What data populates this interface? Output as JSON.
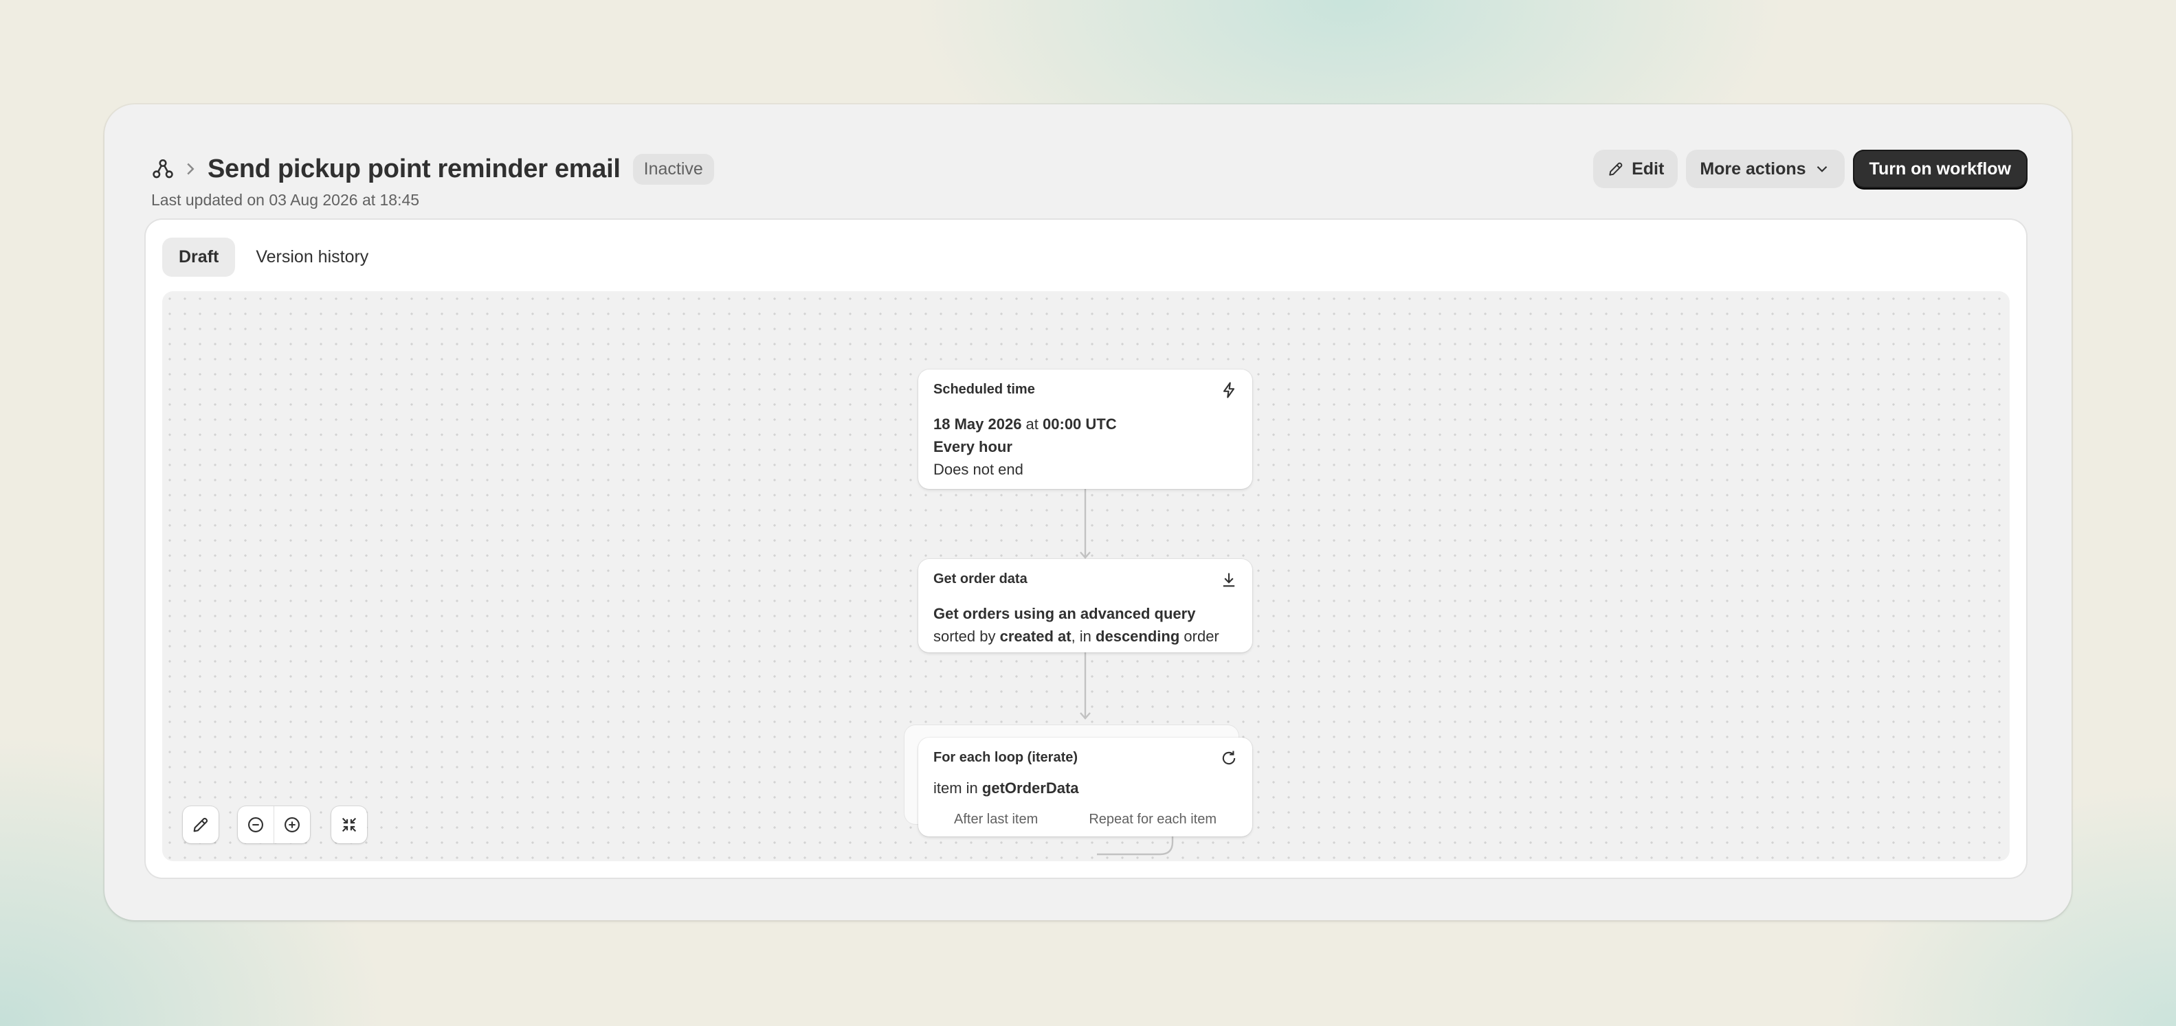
{
  "header": {
    "breadcrumb_icon": "workflow-icon",
    "title": "Send pickup point reminder email",
    "status_badge": "Inactive",
    "last_updated": "Last updated on 03 Aug 2026 at 18:45"
  },
  "actions": {
    "edit_label": "Edit",
    "more_actions_label": "More actions",
    "turn_on_label": "Turn on workflow"
  },
  "tabs": [
    {
      "label": "Draft",
      "active": true
    },
    {
      "label": "Version history",
      "active": false
    }
  ],
  "nodes": {
    "trigger": {
      "title": "Scheduled time",
      "icon": "lightning-icon",
      "date": "18 May 2026",
      "at": " at ",
      "time": "00:00 UTC",
      "frequency": "Every hour",
      "end": "Does not end"
    },
    "get_data": {
      "title": "Get order data",
      "icon": "download-icon",
      "text1": "Get orders using an advanced query",
      "text2": " sorted by ",
      "text3": "created at",
      "text4": ", in ",
      "text5": "descending",
      "text6": " order"
    },
    "loop": {
      "title": "For each loop (iterate)",
      "icon": "refresh-icon",
      "prefix": "item in ",
      "variable": "getOrderData",
      "branch_left": "After last item",
      "branch_right": "Repeat for each item"
    }
  },
  "canvas_controls": [
    "edit-icon",
    "zoom-out-icon",
    "zoom-in-icon",
    "collapse-icon"
  ]
}
